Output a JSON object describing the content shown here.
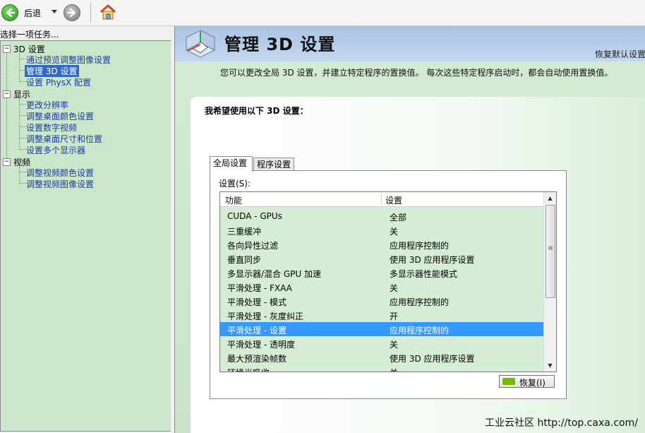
{
  "toolbar": {
    "back_label": "后退"
  },
  "left_panel": {
    "header": "选择一项任务...",
    "tree": [
      {
        "label": "3D 设置",
        "expander": "−",
        "children": [
          "通过预览调整图像设置",
          "管理 3D 设置",
          "设置 PhysX 配置"
        ]
      },
      {
        "label": "显示",
        "expander": "−",
        "children": [
          "更改分辨率",
          "调整桌面颜色设置",
          "设置数字视频",
          "调整桌面尺寸和位置",
          "设置多个显示器"
        ]
      },
      {
        "label": "视频",
        "expander": "−",
        "children": [
          "调整视频颜色设置",
          "调整视频图像设置"
        ]
      }
    ],
    "selected_item": "管理 3D 设置"
  },
  "main": {
    "title": "管理 3D 设置",
    "restore_defaults_link": "恢复默认设置",
    "description": "您可以更改全局 3D 设置，并建立特定程序的置换值。 每次这些特定程序启动时，都会自动使用置换值。",
    "section_title": "我希望使用以下 3D 设置：",
    "tabs": [
      {
        "label": "全局设置",
        "active": true
      },
      {
        "label": "程序设置",
        "active": false
      }
    ],
    "settings_label": "设置(S):",
    "columns": [
      "功能",
      "设置"
    ],
    "rows": [
      {
        "feature": "CUDA - GPUs",
        "value": "全部"
      },
      {
        "feature": "三重缓冲",
        "value": "关"
      },
      {
        "feature": "各向异性过滤",
        "value": "应用程序控制的"
      },
      {
        "feature": "垂直同步",
        "value": "使用 3D 应用程序设置"
      },
      {
        "feature": "多显示器/混合 GPU 加速",
        "value": "多显示器性能模式"
      },
      {
        "feature": "平滑处理 - FXAA",
        "value": "关"
      },
      {
        "feature": "平滑处理 - 模式",
        "value": "应用程序控制的"
      },
      {
        "feature": "平滑处理 - 灰度纠正",
        "value": "开"
      },
      {
        "feature": "平滑处理 - 设置",
        "value": "应用程序控制的"
      },
      {
        "feature": "平滑处理 - 透明度",
        "value": "关"
      },
      {
        "feature": "最大预渲染帧数",
        "value": "使用 3D 应用程序设置"
      },
      {
        "feature": "环境光吸收",
        "value": "关"
      }
    ],
    "selected_row": 8,
    "restore_button": "恢复(I)"
  },
  "watermark": "工业云社区 http://top.caxa.com/",
  "colors": {
    "tree_bg": "#cbe6cb",
    "banner_bg": "#a9c3e4",
    "selection": "#3399ff",
    "nvidia_green": "#76b900"
  }
}
